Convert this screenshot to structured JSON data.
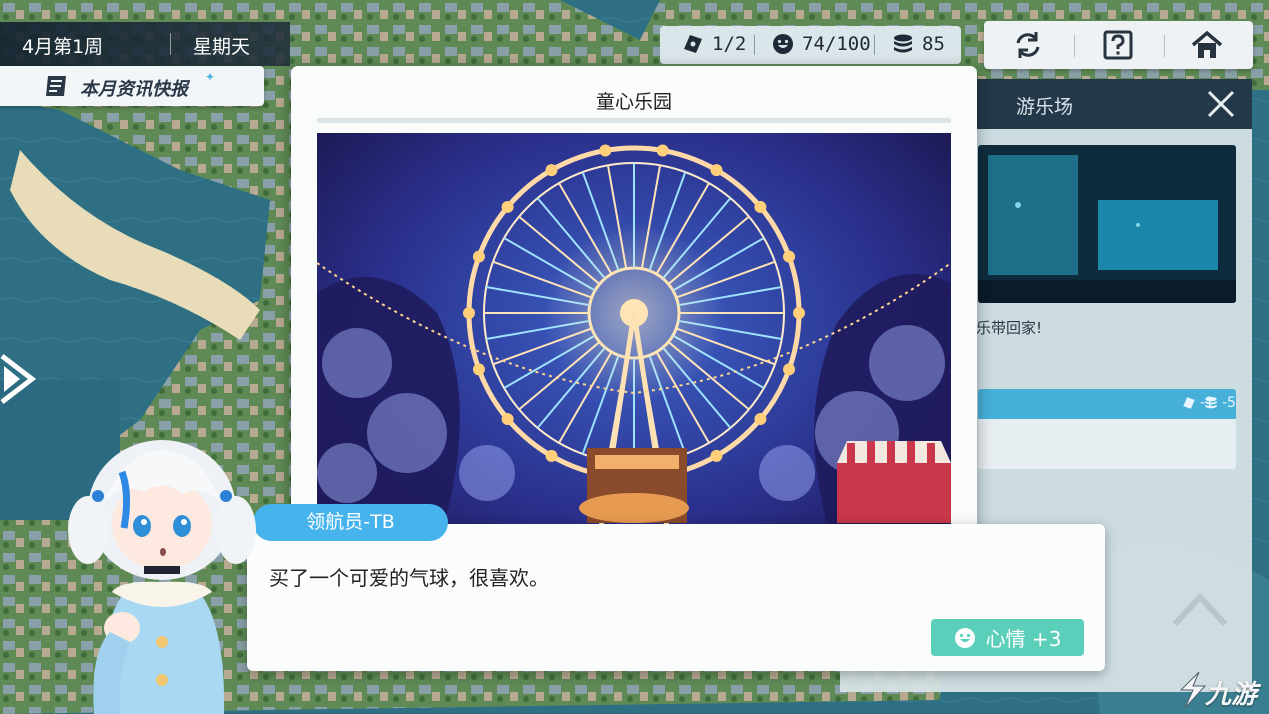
{
  "date": {
    "week": "4月第1周",
    "weekday": "星期天"
  },
  "news": {
    "label": "本月资讯快报"
  },
  "resources": {
    "tickets": "1/2",
    "mood": "74/100",
    "coins": "85"
  },
  "top_buttons": [
    "refresh-icon",
    "help-icon",
    "home-icon"
  ],
  "side_panel": {
    "title": "游乐场",
    "desc_fragment": "乐带回家!",
    "cost_ticket": "-1",
    "cost_coin": "-5"
  },
  "card": {
    "title": "童心乐园"
  },
  "dialogue": {
    "speaker": "领航员-TB",
    "text": "买了一个可爱的气球，很喜欢。",
    "mood_reward": "心情 +3"
  },
  "watermark": {
    "text": "九游"
  },
  "colors": {
    "accent_blue": "#46b3ec",
    "mood_green": "#5ccfbb",
    "panel_dark": "#233848"
  }
}
